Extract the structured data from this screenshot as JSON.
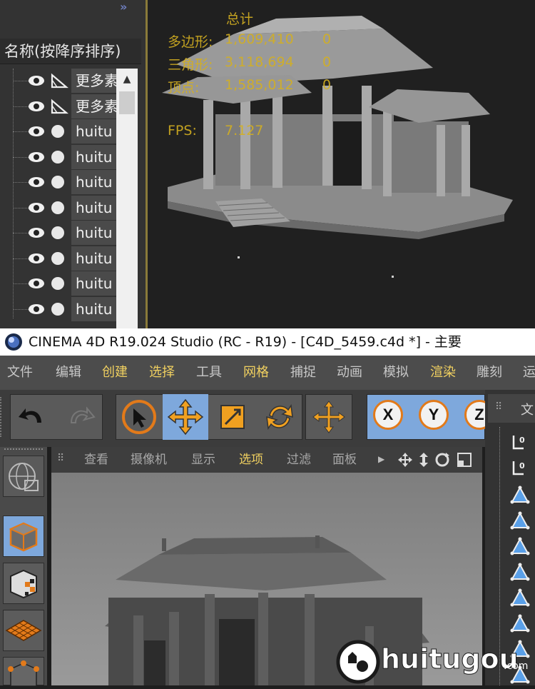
{
  "object_manager": {
    "collapse_glyph": "»",
    "column_header": "名称(按降序排序)",
    "rows": [
      {
        "icon": "polygon-tool-icon",
        "label": "更多素"
      },
      {
        "icon": "polygon-tool-icon",
        "label": "更多素"
      },
      {
        "icon": "sphere-dot-icon",
        "label": "huitu"
      },
      {
        "icon": "sphere-dot-icon",
        "label": "huitu"
      },
      {
        "icon": "sphere-dot-icon",
        "label": "huitu"
      },
      {
        "icon": "sphere-dot-icon",
        "label": "huitu"
      },
      {
        "icon": "sphere-dot-icon",
        "label": "huitu"
      },
      {
        "icon": "sphere-dot-icon",
        "label": "huitu"
      },
      {
        "icon": "sphere-dot-icon",
        "label": "huitu"
      },
      {
        "icon": "sphere-dot-icon",
        "label": "huitu"
      }
    ]
  },
  "stats": {
    "header": "总计",
    "polygons_label": "多边形:",
    "polygons_value": "1,609,410",
    "polygons_sel": "0",
    "triangles_label": "三角形:",
    "triangles_value": "3,118,694",
    "triangles_sel": "0",
    "vertices_label": "顶点:",
    "vertices_value": "1,585,012",
    "vertices_sel": "0",
    "fps_label": "FPS:",
    "fps_value": "7.127"
  },
  "window": {
    "title": "CINEMA 4D R19.024 Studio (RC - R19) - [C4D_5459.c4d *] - 主要"
  },
  "menu": [
    "文件",
    "编辑",
    "创建",
    "选择",
    "工具",
    "网格",
    "捕捉",
    "动画",
    "模拟",
    "渲染",
    "雕刻",
    "运"
  ],
  "menu_highlighted": [
    "创建",
    "选择",
    "网格",
    "渲染"
  ],
  "toolbar": {
    "undo_icon": "undo-icon",
    "redo_icon": "redo-icon",
    "tools": [
      "select-arrow-icon",
      "move-icon",
      "scale-icon",
      "rotate-icon",
      "move-add-icon"
    ],
    "axes": [
      "X",
      "Y",
      "Z"
    ]
  },
  "viewport_menu": {
    "items": [
      "查看",
      "摄像机",
      "显示",
      "选项",
      "过滤",
      "面板"
    ],
    "highlighted": "选项",
    "nav_icons": [
      "arrow-right-icon",
      "pan-icon",
      "dolly-icon",
      "orbit-icon",
      "maximize-icon"
    ]
  },
  "right_panel": {
    "tab_label": "文"
  },
  "watermark": {
    "text": "huitugou",
    "suffix": ".com"
  },
  "colors": {
    "accent_blue": "#7ea8dc",
    "accent_orange": "#e27a1a",
    "stat_yellow": "#d4b020",
    "menu_highlight": "#f0d060"
  }
}
